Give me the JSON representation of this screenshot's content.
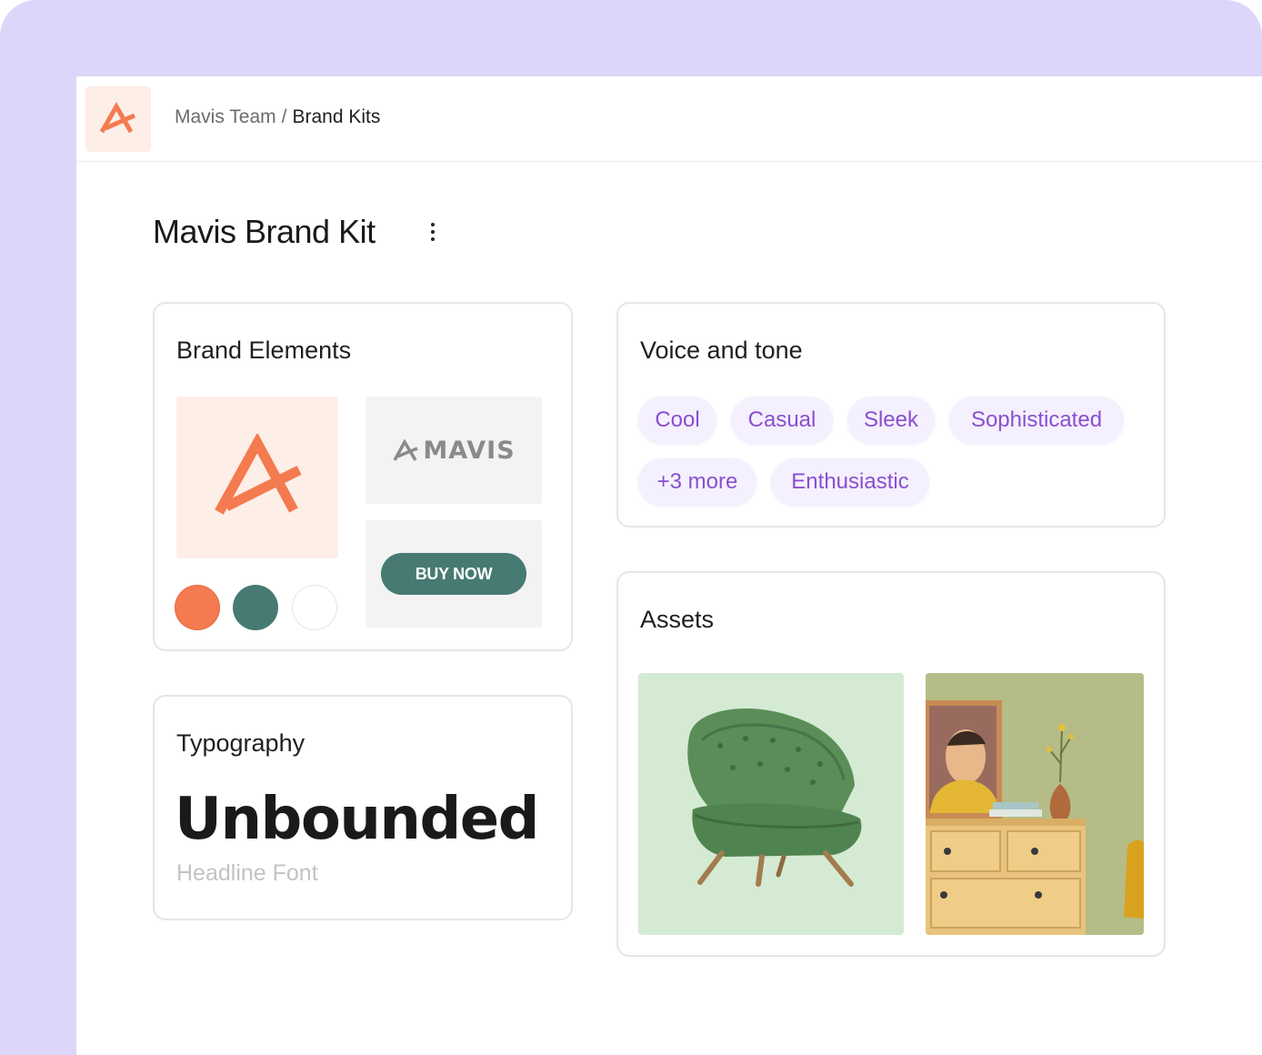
{
  "breadcrumb": {
    "parent": "Mavis Team",
    "separator": "/",
    "current": "Brand Kits"
  },
  "page": {
    "title": "Mavis Brand Kit"
  },
  "brand_elements": {
    "title": "Brand Elements",
    "wordmark": "MAVIS",
    "button_label": "BUY NOW",
    "colors": [
      "#f47a4f",
      "#467a72",
      "#ffffff"
    ]
  },
  "voice": {
    "title": "Voice and tone",
    "tags": [
      "Cool",
      "Casual",
      "Sleek",
      "Sophisticated",
      "+3 more",
      "Enthusiastic"
    ]
  },
  "typography": {
    "title": "Typography",
    "font_name": "Unbounded",
    "font_role": "Headline Font"
  },
  "assets": {
    "title": "Assets",
    "items": [
      "green-armchair-image",
      "dresser-with-painting-image"
    ]
  },
  "theme": {
    "accent": "#f47a4f",
    "primary": "#467a72",
    "chip_text": "#8a4fd0",
    "background": "#dcd6fb"
  }
}
